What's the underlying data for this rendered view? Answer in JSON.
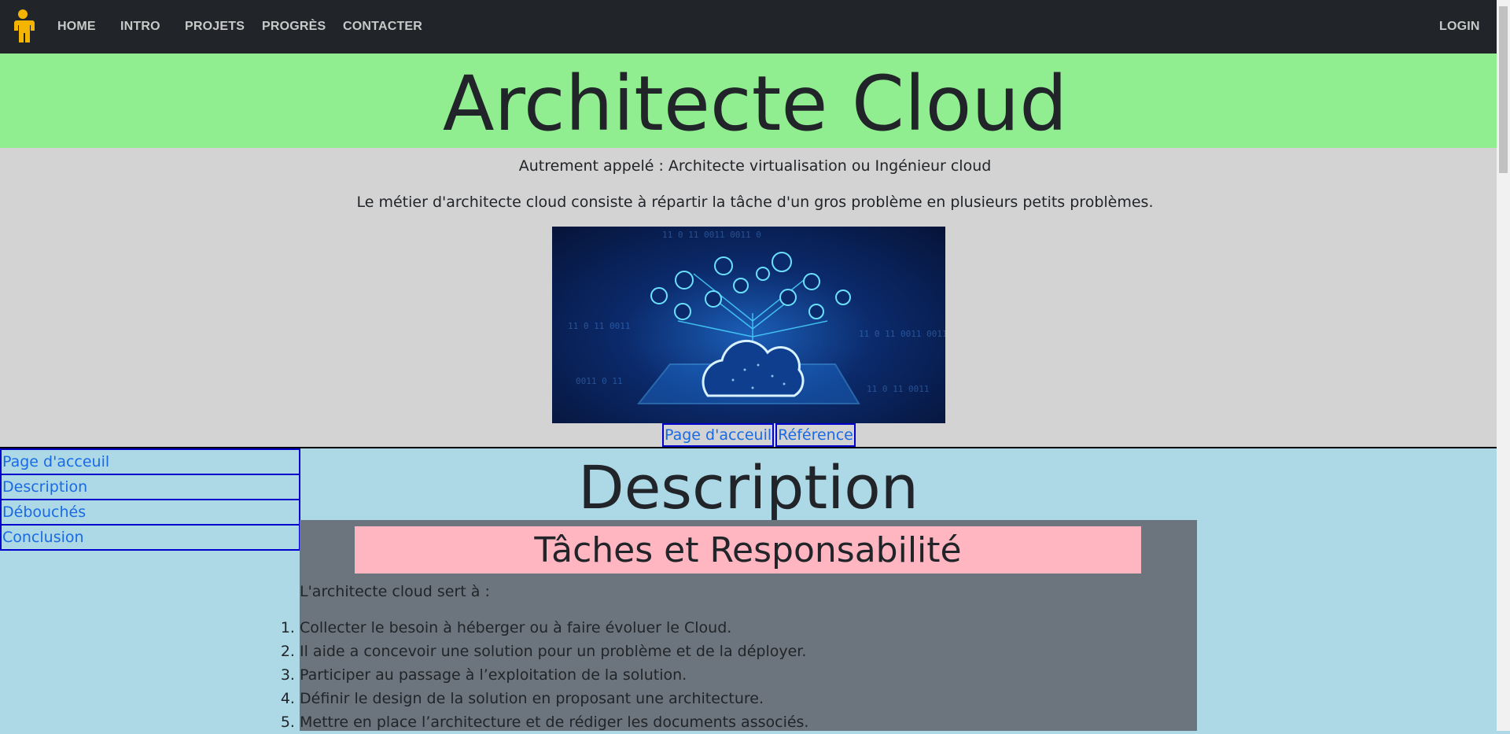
{
  "nav": {
    "items": [
      "HOME",
      "INTRO",
      "PROJETS",
      "PROGRÈS",
      "CONTACTER"
    ],
    "login": "LOGIN",
    "logo_icon": "person-icon",
    "logo_color": "#f4b400"
  },
  "hero": {
    "title": "Architecte Cloud"
  },
  "intro": {
    "alt_names": "Autrement appelé : Architecte virtualisation ou Ingénieur cloud",
    "description": "Le métier d'architecte cloud consiste à répartir la tâche d'un gros problème en plusieurs petits problèmes.",
    "image_icon": "cloud-network-image"
  },
  "ref_nav": {
    "home": "Page d'acceuil",
    "reference": "Référence"
  },
  "sidebar": {
    "items": [
      "Page d'acceuil",
      "Description",
      "Débouchés",
      "Conclusion"
    ]
  },
  "main": {
    "title": "Description",
    "section_title": "Tâches et Responsabilité",
    "lead": "L'architecte cloud sert à :",
    "tasks": [
      "Collecter le besoin à héberger ou à faire évoluer le Cloud.",
      "Il aide a concevoir une solution pour un problème et de la déployer.",
      "Participer au passage à l’exploitation de la solution.",
      "Définir le design de la solution en proposant une architecture.",
      "Mettre en place l’architecture et de rédiger les documents associés."
    ]
  },
  "colors": {
    "navbar": "#212529",
    "hero_bg": "#90ee90",
    "grey_bg": "#d3d3d3",
    "body_bg": "#add8e6",
    "article_bg": "#6c757d",
    "section_title_bg": "#ffb6c1",
    "link_border": "#0000cd"
  }
}
